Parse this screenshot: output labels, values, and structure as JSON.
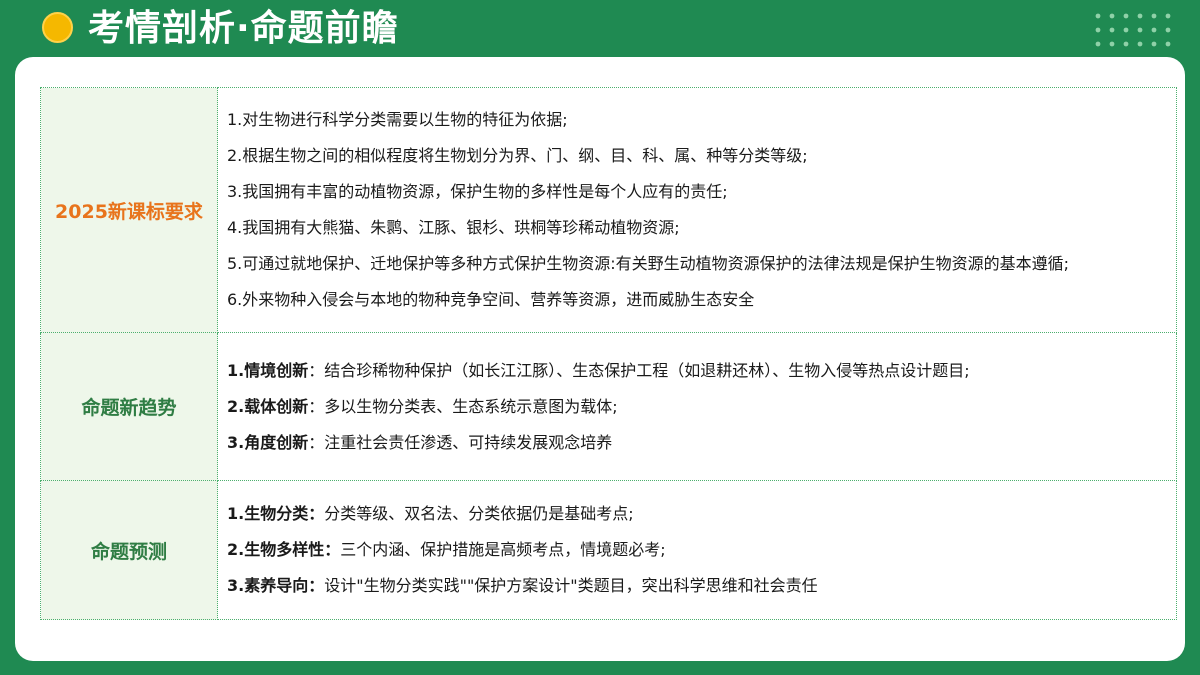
{
  "header": {
    "title": "考情剖析·命题前瞻"
  },
  "sections": [
    {
      "label": "2025新课标要求",
      "lines": [
        "1.对生物进行科学分类需要以生物的特征为依据;",
        "2.根据生物之间的相似程度将生物划分为界、门、纲、目、科、属、种等分类等级;",
        "3.我国拥有丰富的动植物资源，保护生物的多样性是每个人应有的责任;",
        "4.我国拥有大熊猫、朱鹮、江豚、银杉、珙桐等珍稀动植物资源;",
        "5.可通过就地保护、迁地保护等多种方式保护生物资源:有关野生动植物资源保护的法律法规是保护生物资源的基本遵循;",
        "6.外来物种入侵会与本地的物种竞争空间、营养等资源，进而威胁生态安全"
      ]
    },
    {
      "label": "命题新趋势",
      "items": [
        {
          "bold": "1.情境创新",
          "text": "：结合珍稀物种保护（如长江江豚）、生态保护工程（如退耕还林）、生物入侵等热点设计题目;"
        },
        {
          "bold": "2.载体创新",
          "text": "：多以生物分类表、生态系统示意图为载体;"
        },
        {
          "bold": "3.角度创新",
          "text": "：注重社会责任渗透、可持续发展观念培养"
        }
      ]
    },
    {
      "label": "命题预测",
      "items": [
        {
          "bold": "1.生物分类：",
          "text": "分类等级、双名法、分类依据仍是基础考点;"
        },
        {
          "bold": "2.生物多样性：",
          "text": "三个内涵、保护措施是高频考点，情境题必考;"
        },
        {
          "bold": "3.素养导向：",
          "text": "设计\"生物分类实践\"\"保护方案设计\"类题目，突出科学思维和社会责任"
        }
      ]
    }
  ],
  "colors": {
    "background": "#1f8a52",
    "accent_dot": "#f5b800",
    "label_orange": "#e8741c",
    "label_green": "#2f7d44",
    "label_bg": "#eef7ea",
    "border": "#4caf6e"
  },
  "icons": {
    "title_marker": "yellow-circle-icon",
    "decoration": "dot-grid-icon"
  }
}
